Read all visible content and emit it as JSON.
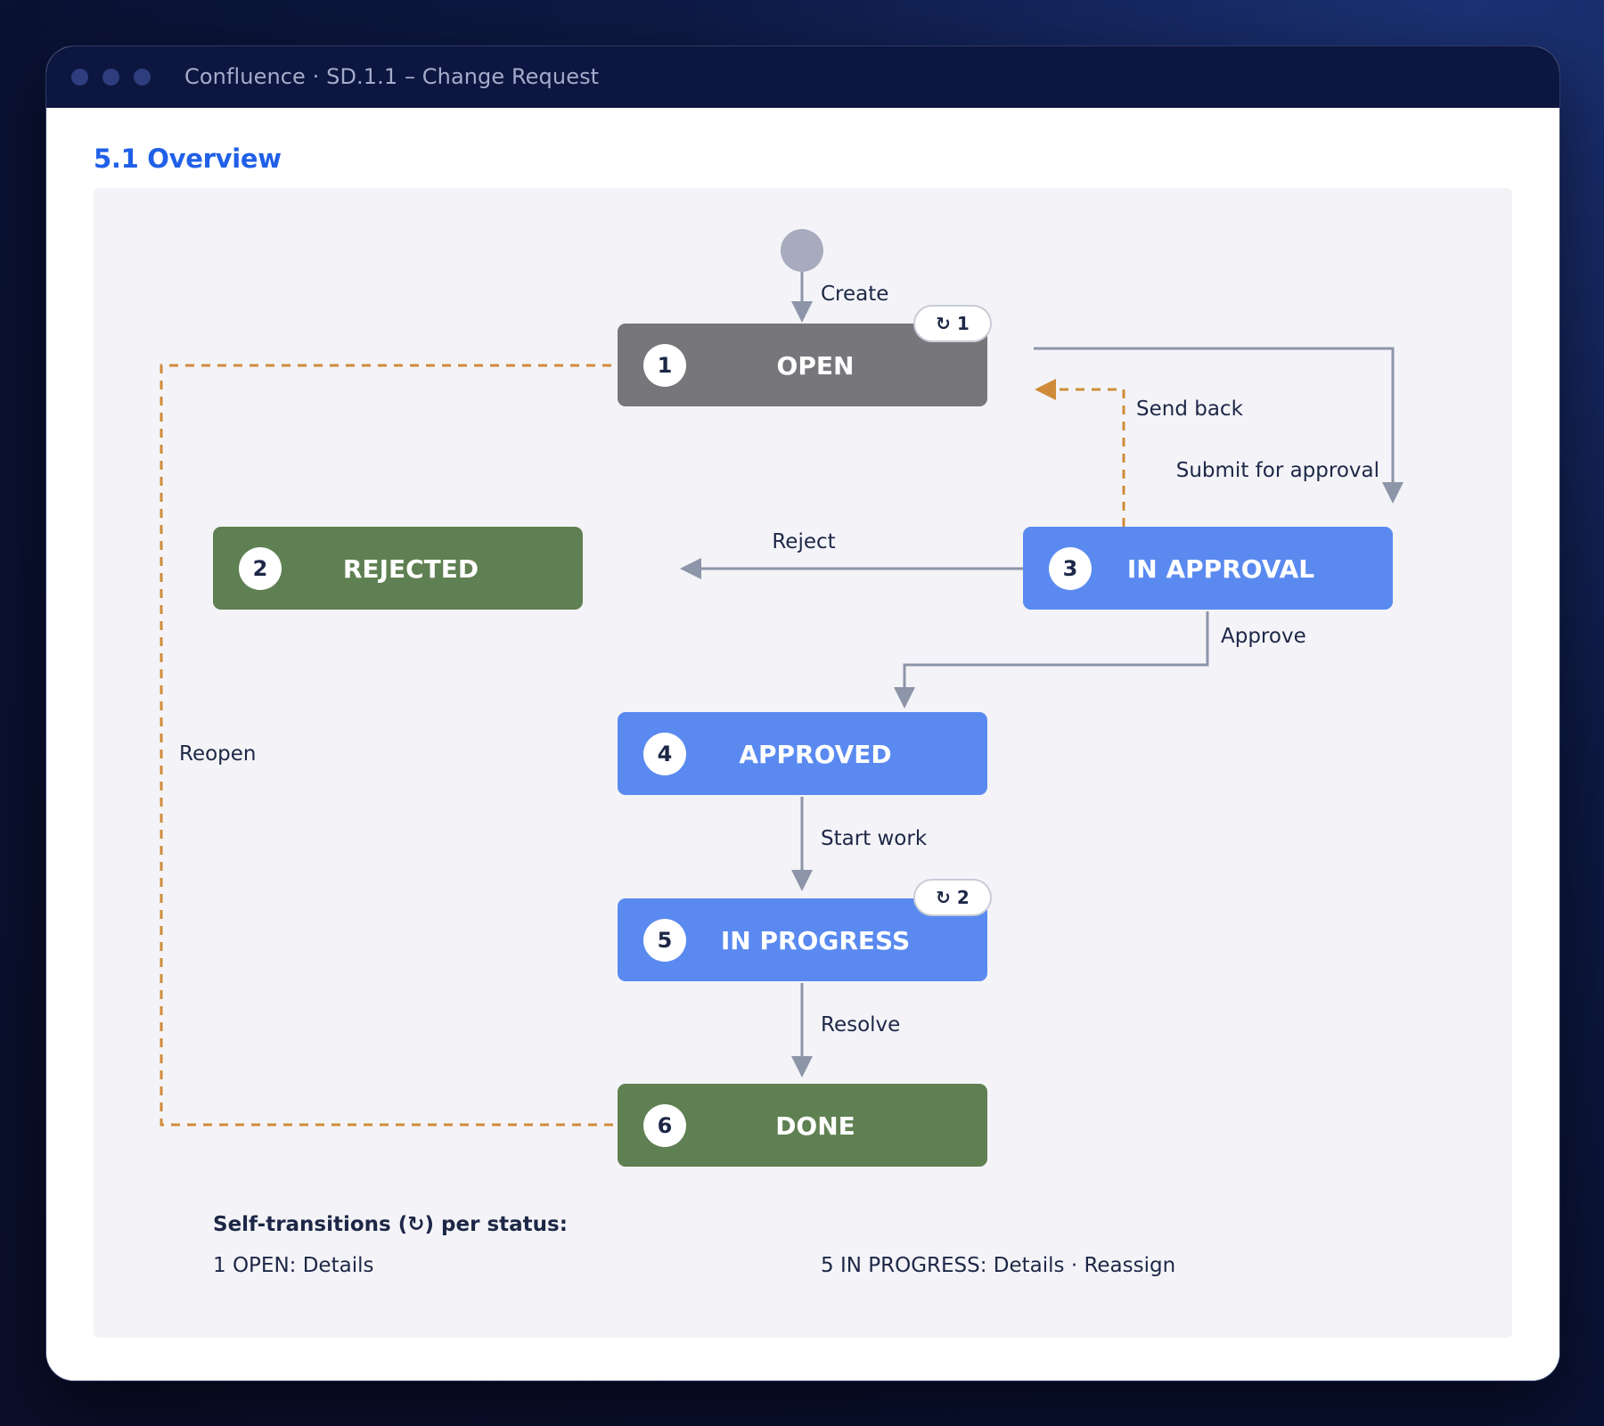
{
  "window": {
    "title": "Confluence · SD.1.1 – Change Request"
  },
  "section": {
    "title": "5.1 Overview"
  },
  "colors": {
    "open": "#77767b",
    "final_green": "#5f8052",
    "active_blue": "#5a8af0",
    "solid_edge": "#8d95a8",
    "dashed_edge": "#d08b3a",
    "start_node": "#a7abbd"
  },
  "states": [
    {
      "num": "1",
      "label": "OPEN"
    },
    {
      "num": "2",
      "label": "REJECTED"
    },
    {
      "num": "3",
      "label": "IN APPROVAL"
    },
    {
      "num": "4",
      "label": "APPROVED"
    },
    {
      "num": "5",
      "label": "IN PROGRESS"
    },
    {
      "num": "6",
      "label": "DONE"
    }
  ],
  "badges": {
    "open": "↻ 1",
    "in_progress": "↻ 2"
  },
  "transitions": {
    "create": "Create",
    "send_back": "Send back",
    "submit_for_approval": "Submit for approval",
    "reject": "Reject",
    "approve": "Approve",
    "reopen": "Reopen",
    "start_work": "Start work",
    "resolve": "Resolve"
  },
  "legend": {
    "title": "Self-transitions (↻) per status:",
    "items": [
      "1 OPEN: Details",
      "5 IN PROGRESS: Details · Reassign"
    ]
  }
}
